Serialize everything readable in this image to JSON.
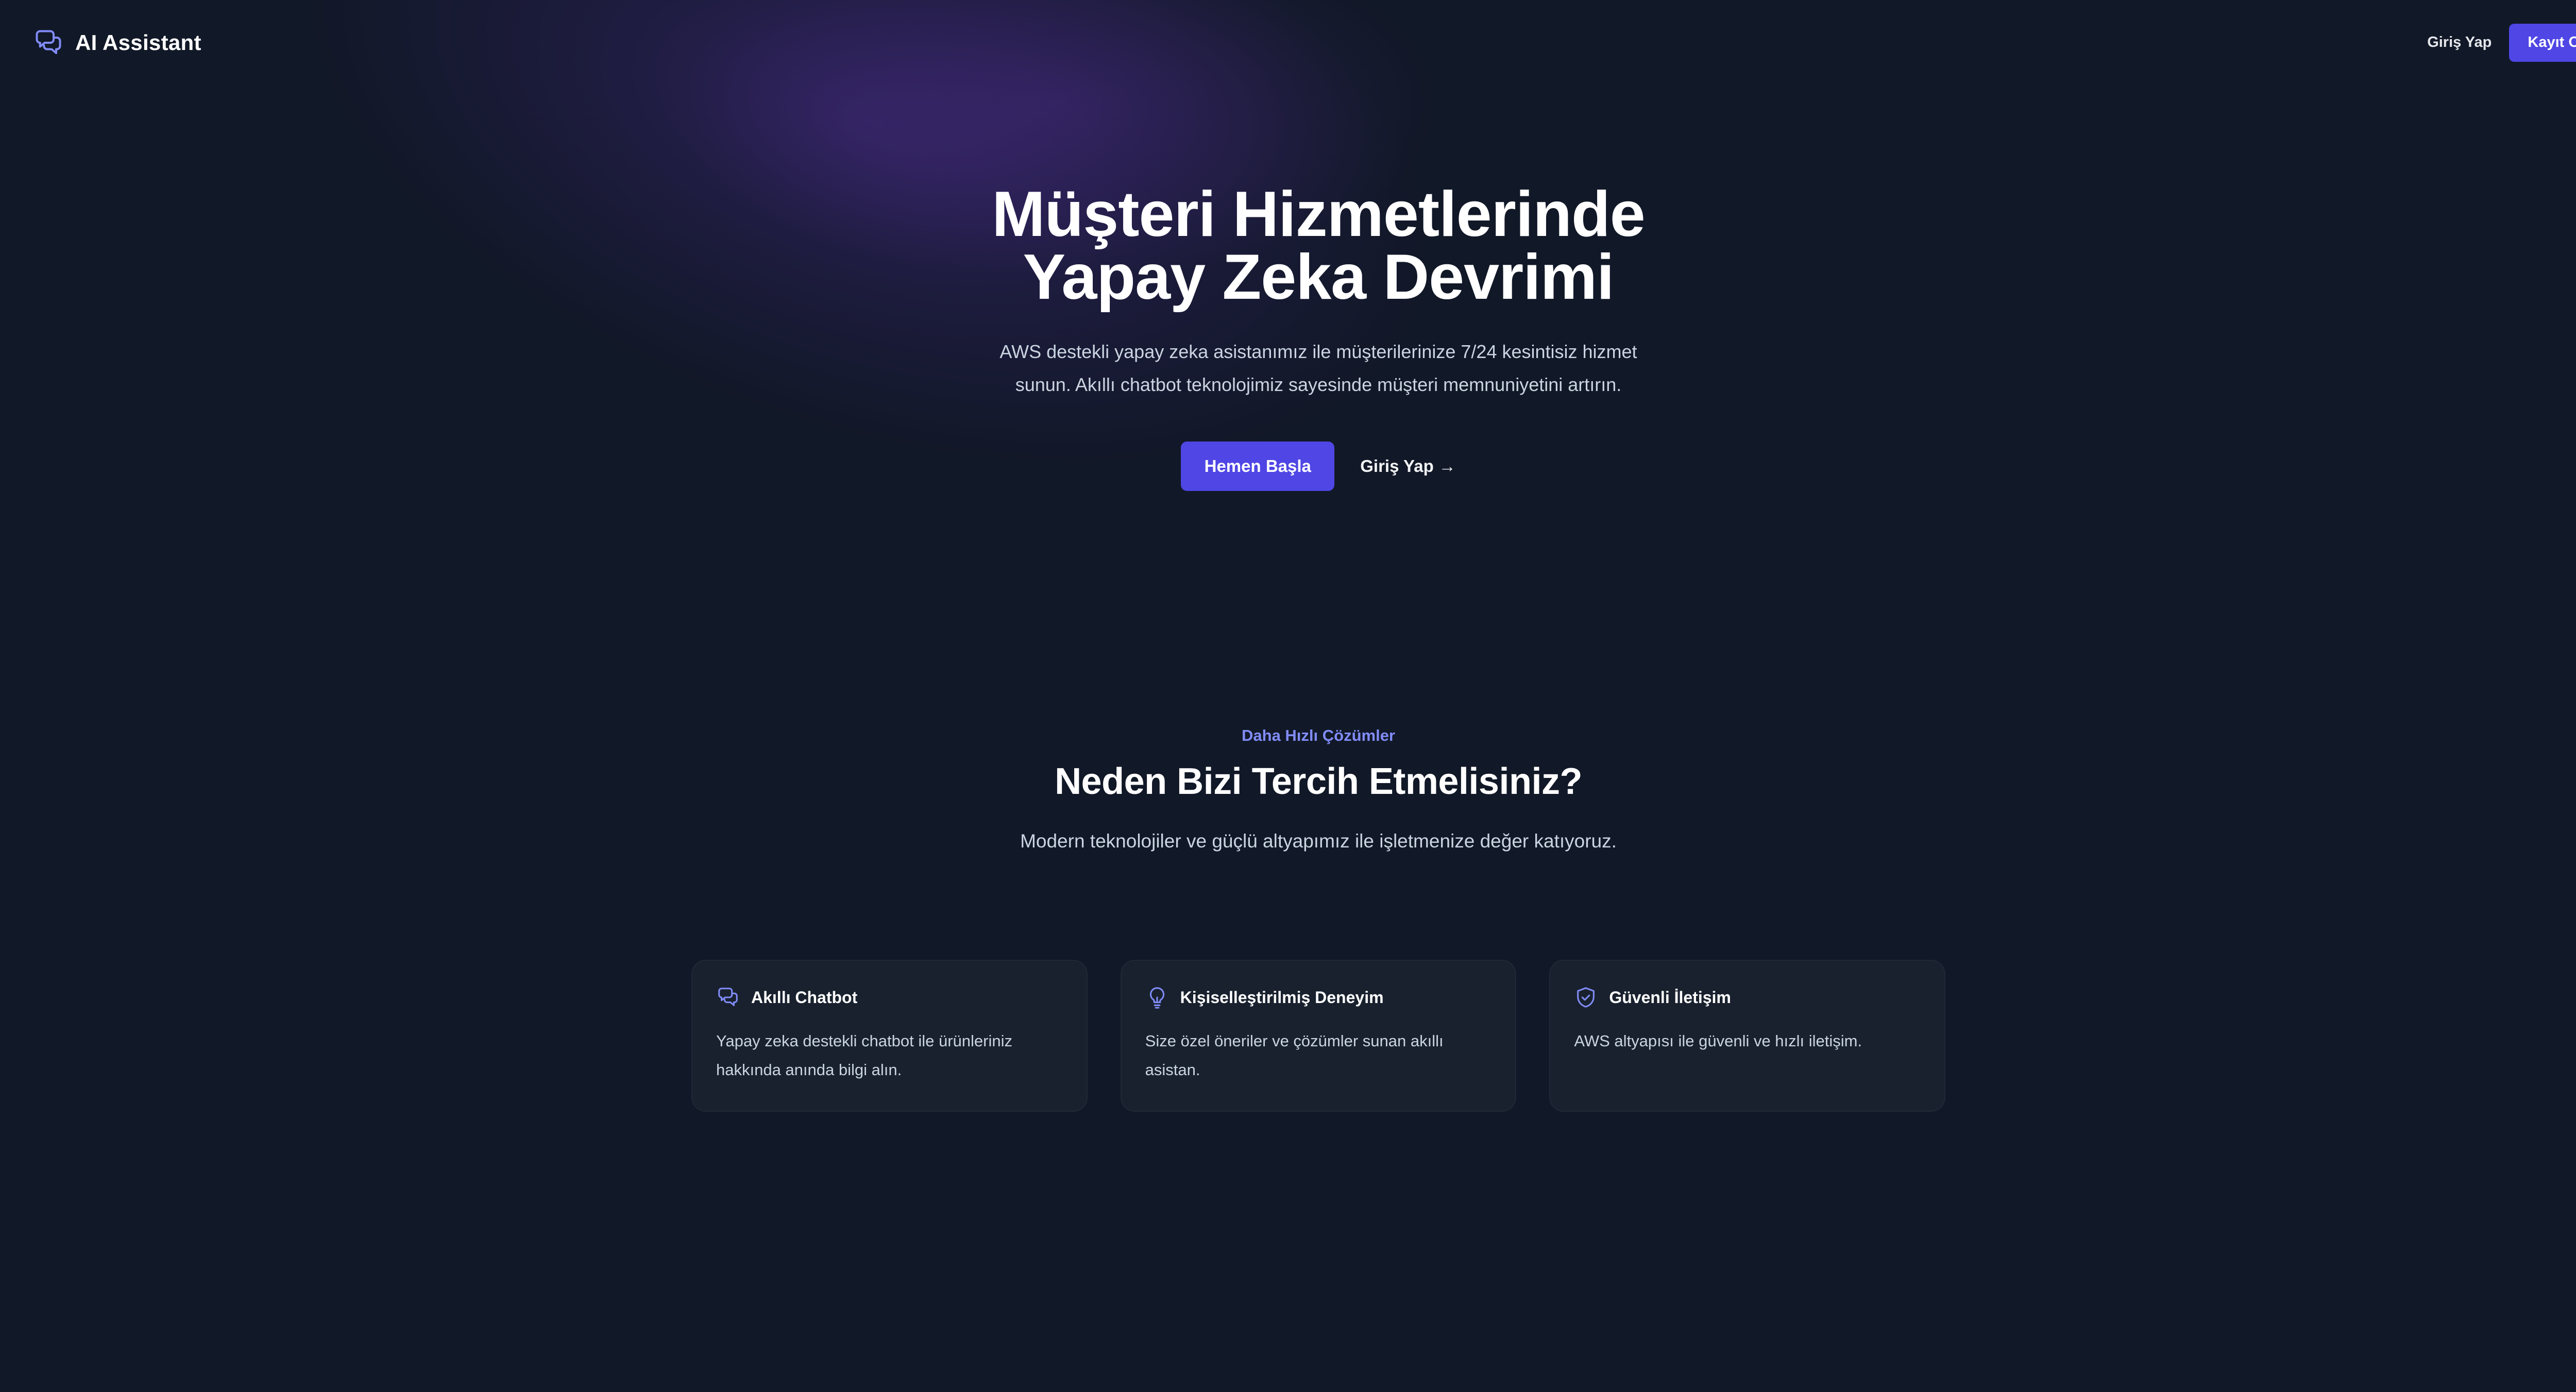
{
  "colors": {
    "background": "#111827",
    "accent": "#4f46e5",
    "accent_light": "#818cf8",
    "card": "#19212e"
  },
  "header": {
    "brand_icon": "chat-bubbles-icon",
    "brand_name": "AI Assistant",
    "login_label": "Giriş Yap",
    "signup_label": "Kayıt Ol"
  },
  "hero": {
    "title_line1": "Müşteri Hizmetlerinde",
    "title_line2": "Yapay Zeka Devrimi",
    "subtitle": "AWS destekli yapay zeka asistanımız ile müşterilerinize 7/24 kesintisiz hizmet sunun. Akıllı chatbot teknolojimiz sayesinde müşteri memnuniyetini artırın.",
    "primary_cta": "Hemen Başla",
    "secondary_cta": "Giriş Yap",
    "secondary_arrow": "→"
  },
  "features": {
    "eyebrow": "Daha Hızlı Çözümler",
    "title": "Neden Bizi Tercih Etmelisiniz?",
    "subtitle": "Modern teknolojiler ve güçlü altyapımız ile işletmenize değer katıyoruz.",
    "cards": [
      {
        "icon": "chat-bubbles-icon",
        "title": "Akıllı Chatbot",
        "text": "Yapay zeka destekli chatbot ile ürünleriniz hakkında anında bilgi alın."
      },
      {
        "icon": "lightbulb-icon",
        "title": "Kişiselleştirilmiş Deneyim",
        "text": "Size özel öneriler ve çözümler sunan akıllı asistan."
      },
      {
        "icon": "shield-check-icon",
        "title": "Güvenli İletişim",
        "text": "AWS altyapısı ile güvenli ve hızlı iletişim."
      }
    ]
  }
}
